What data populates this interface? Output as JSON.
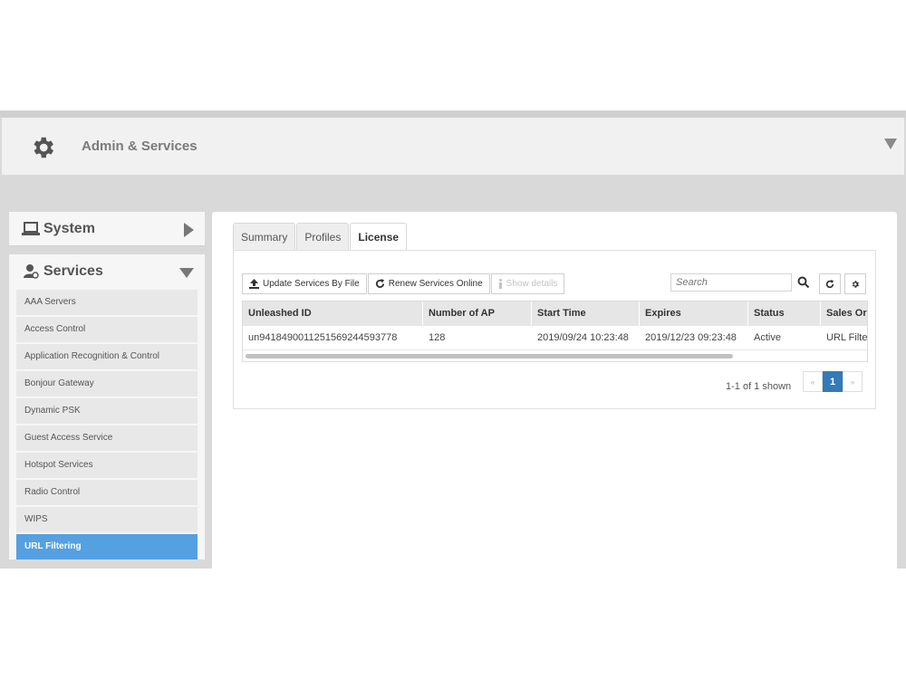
{
  "header": {
    "title": "Admin & Services"
  },
  "sidebar": {
    "system_label": "System",
    "services_label": "Services",
    "items": [
      {
        "label": "AAA Servers"
      },
      {
        "label": "Access Control"
      },
      {
        "label": "Application Recognition & Control"
      },
      {
        "label": "Bonjour Gateway"
      },
      {
        "label": "Dynamic PSK"
      },
      {
        "label": "Guest Access Service"
      },
      {
        "label": "Hotspot Services"
      },
      {
        "label": "Radio Control"
      },
      {
        "label": "WIPS"
      },
      {
        "label": "URL Filtering",
        "active": true
      }
    ]
  },
  "tabs": [
    {
      "label": "Summary"
    },
    {
      "label": "Profiles"
    },
    {
      "label": "License",
      "active": true
    }
  ],
  "toolbar": {
    "update_label": "Update Services By File",
    "renew_label": "Renew Services Online",
    "details_label": "Show details",
    "search_placeholder": "Search"
  },
  "table": {
    "columns": [
      "Unleashed ID",
      "Number of AP",
      "Start Time",
      "Expires",
      "Status",
      "Sales Or"
    ],
    "rows": [
      [
        "un9418490011251569244593778",
        "128",
        "2019/09/24 10:23:48",
        "2019/12/23 09:23:48",
        "Active",
        "URL Filte"
      ]
    ]
  },
  "pagination": {
    "info": "1-1 of 1 shown",
    "prev": "«",
    "current": "1",
    "next": "»"
  },
  "colors": {
    "active_item": "#55a0e1",
    "current_page": "#337ab7"
  }
}
